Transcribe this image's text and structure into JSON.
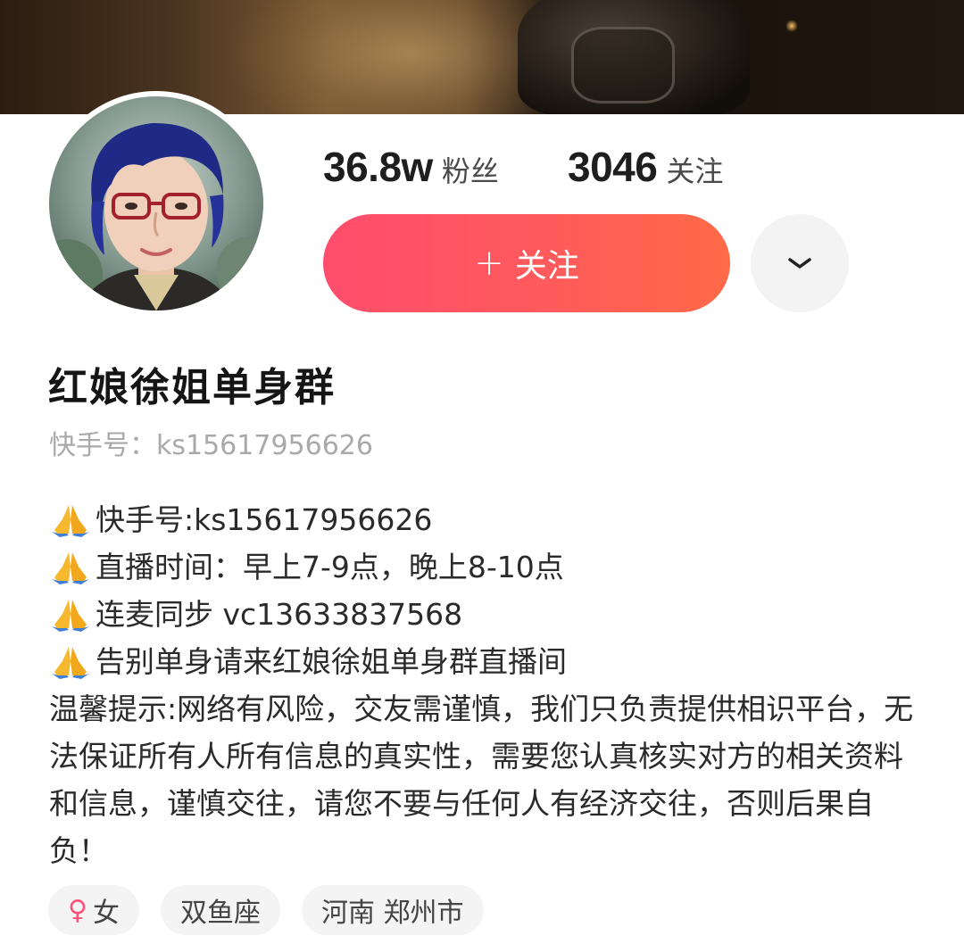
{
  "stats": {
    "fans_value": "36.8w",
    "fans_label": "粉丝",
    "following_value": "3046",
    "following_label": "关注"
  },
  "actions": {
    "follow_plus": "+",
    "follow_label": "关注",
    "more_icon": "chevron-down-icon"
  },
  "profile": {
    "name": "红娘徐姐单身群",
    "id_label": "快手号：",
    "id_value": "ks15617956626"
  },
  "bio": {
    "lines": [
      "快手号:ks15617956626",
      "直播时间：早上7-9点，晚上8-10点",
      "连麦同步 vc13633837568",
      "告别单身请来红娘徐姐单身群直播间"
    ],
    "notice": "温馨提示:网络有风险，交友需谨慎，我们只负责提供相识平台，无法保证所有人所有信息的真实性，需要您认真核实对方的相关资料和信息，谨慎交往，请您不要与任何人有经济交往，否则后果自负！"
  },
  "tags": {
    "gender_symbol": "♀",
    "gender": "女",
    "zodiac": "双鱼座",
    "location": "河南 郑州市"
  },
  "colors": {
    "follow_start": "#ff4d6d",
    "follow_end": "#ff6a47",
    "female_pink": "#ff4f7b"
  }
}
